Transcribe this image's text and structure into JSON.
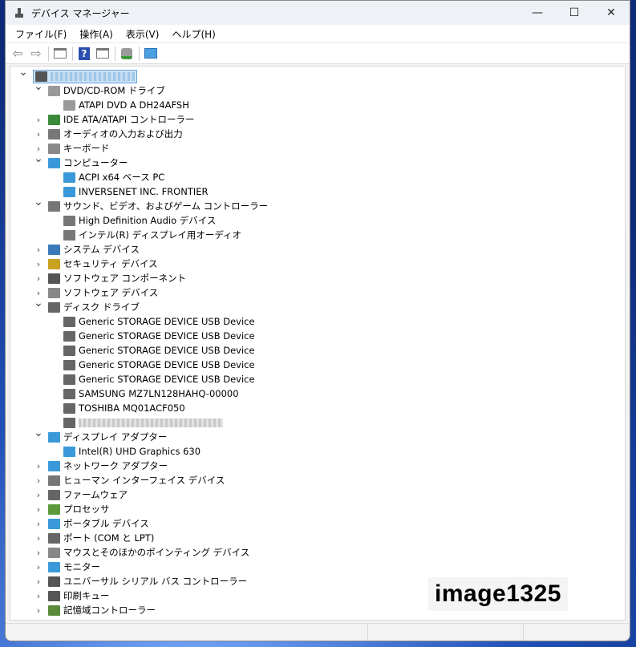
{
  "window": {
    "title": "デバイス マネージャー",
    "minimize": "—",
    "maximize": "☐",
    "close": "✕"
  },
  "menu": [
    "ファイル(F)",
    "操作(A)",
    "表示(V)",
    "ヘルプ(H)"
  ],
  "tree": [
    {
      "label": "",
      "level": 0,
      "exp": "open",
      "icon": "computer-root",
      "color": "#555",
      "redacted": true
    },
    {
      "label": "DVD/CD-ROM ドライブ",
      "level": 1,
      "exp": "open",
      "icon": "dvd",
      "color": "#999"
    },
    {
      "label": "ATAPI DVD A  DH24AFSH",
      "level": 2,
      "icon": "dvd",
      "color": "#999"
    },
    {
      "label": "IDE ATA/ATAPI コントローラー",
      "level": 1,
      "exp": "closed",
      "icon": "ide",
      "color": "#3a8a3a"
    },
    {
      "label": "オーディオの入力および出力",
      "level": 1,
      "exp": "closed",
      "icon": "speaker",
      "color": "#777"
    },
    {
      "label": "キーボード",
      "level": 1,
      "exp": "closed",
      "icon": "keyboard",
      "color": "#888"
    },
    {
      "label": "コンピューター",
      "level": 1,
      "exp": "open",
      "icon": "monitor",
      "color": "#3a9ad9"
    },
    {
      "label": "ACPI x64 ベース PC",
      "level": 2,
      "icon": "monitor",
      "color": "#3a9ad9"
    },
    {
      "label": "INVERSENET INC. FRONTIER",
      "level": 2,
      "icon": "monitor",
      "color": "#3a9ad9"
    },
    {
      "label": "サウンド、ビデオ、およびゲーム コントローラー",
      "level": 1,
      "exp": "open",
      "icon": "speaker",
      "color": "#777"
    },
    {
      "label": "High Definition Audio デバイス",
      "level": 2,
      "icon": "speaker",
      "color": "#777"
    },
    {
      "label": "インテル(R) ディスプレイ用オーディオ",
      "level": 2,
      "icon": "speaker",
      "color": "#777"
    },
    {
      "label": "システム デバイス",
      "level": 1,
      "exp": "closed",
      "icon": "system",
      "color": "#3a7ab9"
    },
    {
      "label": "セキュリティ デバイス",
      "level": 1,
      "exp": "closed",
      "icon": "security",
      "color": "#c9a020"
    },
    {
      "label": "ソフトウェア コンポーネント",
      "level": 1,
      "exp": "closed",
      "icon": "software",
      "color": "#555"
    },
    {
      "label": "ソフトウェア デバイス",
      "level": 1,
      "exp": "closed",
      "icon": "software",
      "color": "#888"
    },
    {
      "label": "ディスク ドライブ",
      "level": 1,
      "exp": "open",
      "icon": "disk",
      "color": "#666"
    },
    {
      "label": "Generic STORAGE DEVICE USB Device",
      "level": 2,
      "icon": "disk",
      "color": "#666"
    },
    {
      "label": "Generic STORAGE DEVICE USB Device",
      "level": 2,
      "icon": "disk",
      "color": "#666"
    },
    {
      "label": "Generic STORAGE DEVICE USB Device",
      "level": 2,
      "icon": "disk",
      "color": "#666"
    },
    {
      "label": "Generic STORAGE DEVICE USB Device",
      "level": 2,
      "icon": "disk",
      "color": "#666"
    },
    {
      "label": "Generic STORAGE DEVICE USB Device",
      "level": 2,
      "icon": "disk",
      "color": "#666"
    },
    {
      "label": "SAMSUNG MZ7LN128HAHQ-00000",
      "level": 2,
      "icon": "disk",
      "color": "#666"
    },
    {
      "label": "TOSHIBA MQ01ACF050",
      "level": 2,
      "icon": "disk",
      "color": "#666"
    },
    {
      "label": "",
      "level": 2,
      "icon": "disk",
      "color": "#666",
      "redacted": true
    },
    {
      "label": "ディスプレイ アダプター",
      "level": 1,
      "exp": "open",
      "icon": "display-adapter",
      "color": "#3a9ad9"
    },
    {
      "label": "Intel(R) UHD Graphics 630",
      "level": 2,
      "icon": "display-adapter",
      "color": "#3a9ad9"
    },
    {
      "label": "ネットワーク アダプター",
      "level": 1,
      "exp": "closed",
      "icon": "network",
      "color": "#3a9ad9"
    },
    {
      "label": "ヒューマン インターフェイス デバイス",
      "level": 1,
      "exp": "closed",
      "icon": "hid",
      "color": "#777"
    },
    {
      "label": "ファームウェア",
      "level": 1,
      "exp": "closed",
      "icon": "firmware",
      "color": "#666"
    },
    {
      "label": "プロセッサ",
      "level": 1,
      "exp": "closed",
      "icon": "processor",
      "color": "#5a9a3a"
    },
    {
      "label": "ポータブル デバイス",
      "level": 1,
      "exp": "closed",
      "icon": "portable",
      "color": "#3a9ad9"
    },
    {
      "label": "ポート (COM と LPT)",
      "level": 1,
      "exp": "closed",
      "icon": "port",
      "color": "#666"
    },
    {
      "label": "マウスとそのほかのポインティング デバイス",
      "level": 1,
      "exp": "closed",
      "icon": "mouse",
      "color": "#888"
    },
    {
      "label": "モニター",
      "level": 1,
      "exp": "closed",
      "icon": "monitor",
      "color": "#3a9ad9"
    },
    {
      "label": "ユニバーサル シリアル バス コントローラー",
      "level": 1,
      "exp": "closed",
      "icon": "usb",
      "color": "#555"
    },
    {
      "label": "印刷キュー",
      "level": 1,
      "exp": "closed",
      "icon": "printer",
      "color": "#555"
    },
    {
      "label": "記憶域コントローラー",
      "level": 1,
      "exp": "closed",
      "icon": "storage-controller",
      "color": "#5a8a3a"
    }
  ],
  "watermark": "image1325"
}
